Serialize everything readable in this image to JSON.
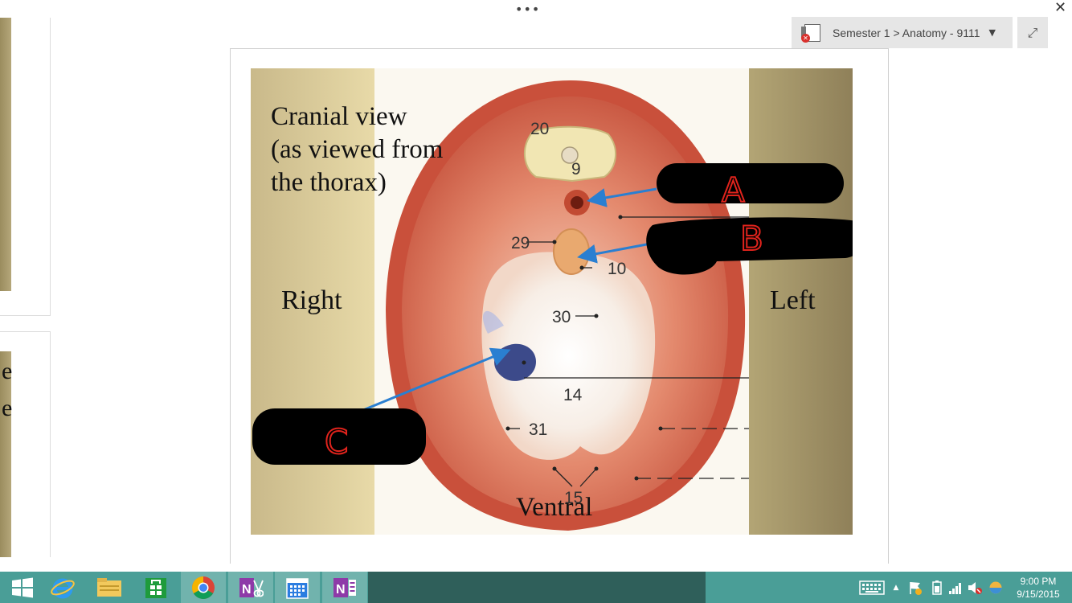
{
  "window": {
    "more_glyph": "•••",
    "close_glyph": "✕",
    "notebook_path": "Semester 1 > Anatomy - 9111",
    "notebook_caret": "▼",
    "expand_glyph": "⤢"
  },
  "left_fragments": [
    "e",
    "e"
  ],
  "figure": {
    "caption": "Cranial view\n(as viewed from\nthe thorax)",
    "side_right": "Right",
    "side_left": "Left",
    "bottom": "Ventral",
    "numbers": [
      "20",
      "9",
      "29",
      "10",
      "30",
      "14",
      "31",
      "15"
    ],
    "annotations": [
      "A",
      "B",
      "C"
    ],
    "colors": {
      "muscle": "#d9644d",
      "panel": "#c8b886",
      "arrow": "#2a7fd1",
      "handwriting": "#e0231c",
      "redaction": "#000000"
    }
  },
  "taskbar": {
    "apps": [
      {
        "name": "start-button",
        "icon": "windows-logo-icon"
      },
      {
        "name": "internet-explorer",
        "icon": "internet-explorer-icon"
      },
      {
        "name": "file-explorer",
        "icon": "folder-icon"
      },
      {
        "name": "store",
        "icon": "store-icon"
      },
      {
        "name": "chrome",
        "icon": "chrome-icon"
      },
      {
        "name": "onenote-clipper",
        "icon": "onenote-scissors-icon"
      },
      {
        "name": "calendar",
        "icon": "calendar-icon"
      },
      {
        "name": "onenote",
        "icon": "onenote-icon"
      }
    ],
    "colors": {
      "bar": "#4a9e97",
      "dark": "#2f5f5a"
    },
    "tray_arrow": "▲",
    "time": "9:00 PM",
    "date": "9/15/2015"
  }
}
